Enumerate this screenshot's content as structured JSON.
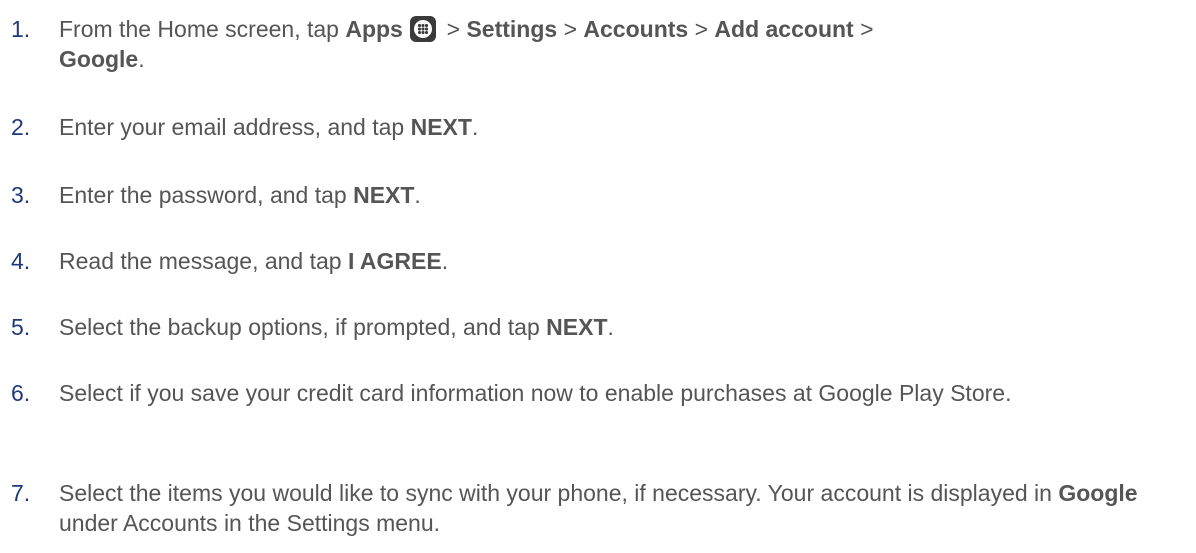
{
  "steps": [
    {
      "number": "1.",
      "parts": {
        "a": "From the Home screen, tap ",
        "b1": "Apps",
        "icon": "apps-icon",
        "c": " > ",
        "b2": "Settings",
        "d": " > ",
        "b3": "Accounts",
        "e": " > ",
        "b4": "Add account",
        "f": " > ",
        "b5": "Google",
        "g": "."
      }
    },
    {
      "number": "2.",
      "parts": {
        "a": "Enter your email address, and tap ",
        "b": "NEXT",
        "c": "."
      }
    },
    {
      "number": "3.",
      "parts": {
        "a": "Enter the password, and tap ",
        "b": "NEXT",
        "c": "."
      }
    },
    {
      "number": "4.",
      "parts": {
        "a": "Read the message, and tap ",
        "b": "I AGREE",
        "c": "."
      }
    },
    {
      "number": "5.",
      "parts": {
        "a": "Select the backup options, if prompted, and tap ",
        "b": "NEXT",
        "c": "."
      }
    },
    {
      "number": "6.",
      "parts": {
        "a": "Select if you save your credit card information now to enable purchases at Google Play Store."
      }
    },
    {
      "number": "7.",
      "parts": {
        "a": "Select the items you would like to sync with your phone, if necessary. Your account is displayed in ",
        "b": "Google",
        "c": " under Accounts in the Settings menu."
      }
    }
  ],
  "colors": {
    "number": "#1e3a7a",
    "text": "#555555",
    "icon": "#3a3a3a"
  }
}
